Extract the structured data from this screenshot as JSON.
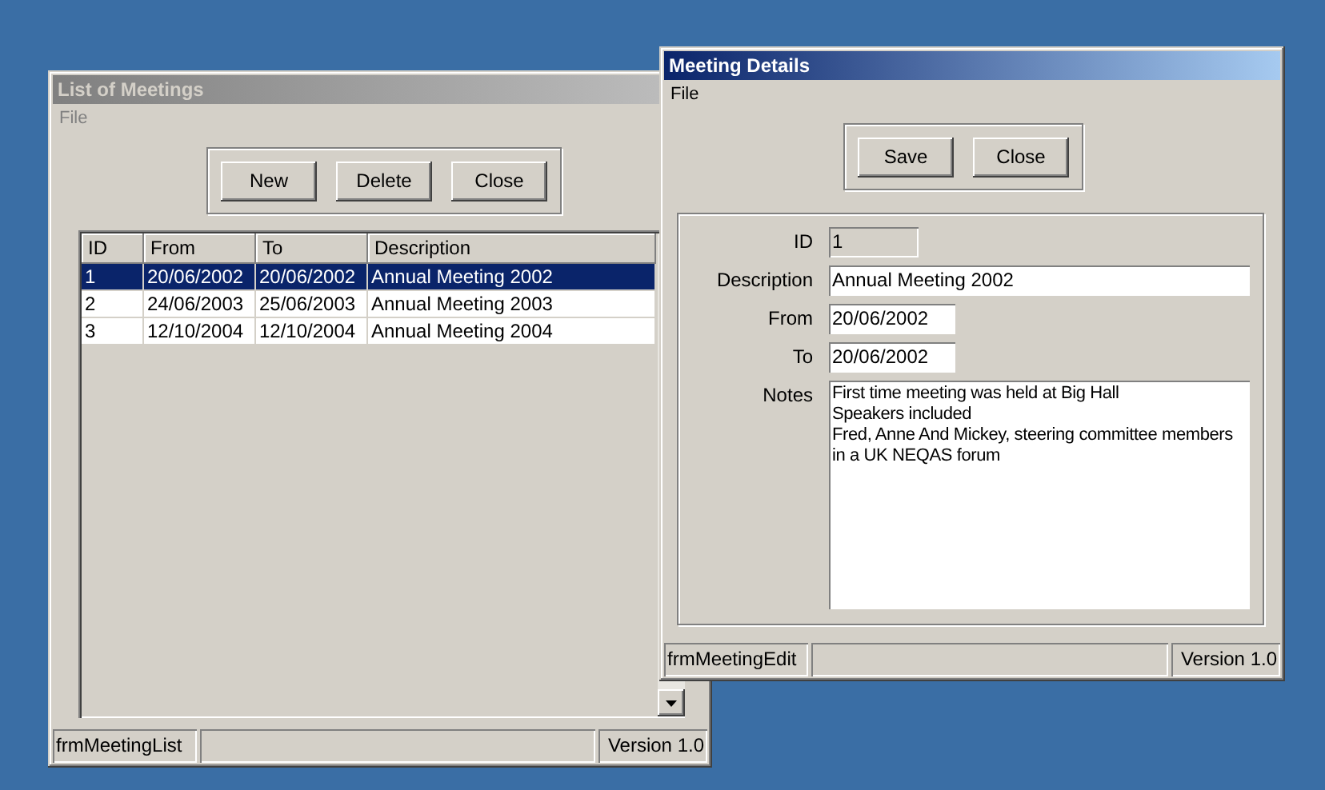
{
  "list_window": {
    "title": "List of Meetings",
    "active": false,
    "menu": [
      "File"
    ],
    "buttons": [
      "New",
      "Delete",
      "Close"
    ],
    "table": {
      "columns": [
        "ID",
        "From",
        "To",
        "Description"
      ],
      "rows": [
        {
          "cells": [
            "1",
            "20/06/2002",
            "20/06/2002",
            "Annual Meeting 2002"
          ],
          "selected": true
        },
        {
          "cells": [
            "2",
            "24/06/2003",
            "25/06/2003",
            "Annual Meeting 2003"
          ],
          "selected": false
        },
        {
          "cells": [
            "3",
            "12/10/2004",
            "12/10/2004",
            "Annual Meeting 2004"
          ],
          "selected": false
        }
      ]
    },
    "status_bar": {
      "left": "frmMeetingList",
      "right": "Version 1.0"
    }
  },
  "detail_window": {
    "title": "Meeting Details",
    "active": true,
    "menu": [
      "File"
    ],
    "buttons": [
      "Save",
      "Close"
    ],
    "fields": [
      {
        "label": "ID",
        "value": "1",
        "kind": "short",
        "disabled": true
      },
      {
        "label": "Description",
        "value": "Annual Meeting 2002",
        "kind": "long",
        "disabled": false
      },
      {
        "label": "From",
        "value": "20/06/2002",
        "kind": "date",
        "disabled": false
      },
      {
        "label": "To",
        "value": "20/06/2002",
        "kind": "date",
        "disabled": false
      },
      {
        "label": "Notes",
        "value": "First time meeting was held at Big Hall\nSpeakers included\nFred, Anne And Mickey, steering committee members\nin a UK NEQAS forum",
        "kind": "multiline",
        "disabled": false
      }
    ],
    "status_bar": {
      "left": "frmMeetingEdit",
      "right": "Version 1.0"
    }
  }
}
